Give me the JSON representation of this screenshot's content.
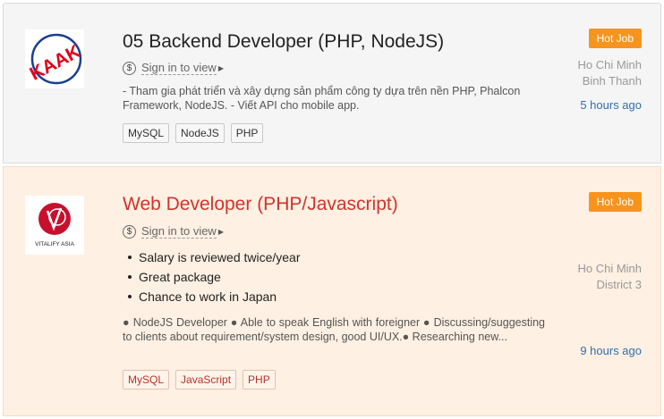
{
  "jobs": [
    {
      "title": "05 Backend Developer (PHP, NodeJS)",
      "logo_text": "KAAK",
      "salary_link": "Sign in to view",
      "description": "- Tham gia phát triển và xây dựng sản phẩm công ty dựa trên nền PHP, Phalcon Framework, NodeJS. - Viết API cho mobile app.",
      "tags": [
        "MySQL",
        "NodeJS",
        "PHP"
      ],
      "badge": "Hot Job",
      "city": "Ho Chi Minh",
      "district": "Binh Thanh",
      "posted": "5 hours ago"
    },
    {
      "title": "Web Developer (PHP/Javascript)",
      "logo_text": "VITALIFY ASIA",
      "salary_link": "Sign in to view",
      "benefits": [
        "Salary is reviewed twice/year",
        "Great package",
        "Chance to work in Japan"
      ],
      "description": "● NodeJS Developer ● Able to speak English with foreigner ● Discussing/suggesting to clients about requirement/system design, good UI/UX.● Researching new...",
      "tags": [
        "MySQL",
        "JavaScript",
        "PHP"
      ],
      "badge": "Hot Job",
      "city": "Ho Chi Minh",
      "district": "District 3",
      "posted": "9 hours ago"
    }
  ],
  "colors": {
    "accent_orange": "#f7941d",
    "title_red": "#d0342c",
    "link_blue": "#2f6fb0",
    "highlight_bg": "#fef0e2"
  },
  "icons": {
    "salary": "dollar-icon",
    "more": "caret-right-icon",
    "logo_1": "kaak-logo",
    "logo_2": "vitalify-asia-logo"
  }
}
